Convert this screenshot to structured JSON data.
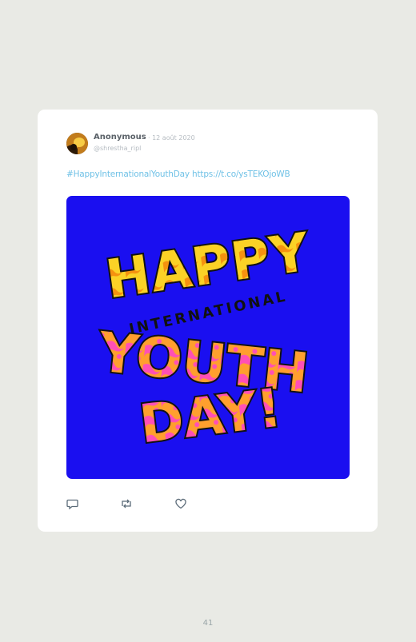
{
  "tweet": {
    "author": "Anonymous",
    "date": "· 12 août 2020",
    "handle": "@shrestha_ripl",
    "hashtag": "#HappyInternationalYouthDay",
    "link": "https://t.co/ysTEKOjoWB",
    "media": {
      "background": "#1a0ff0",
      "line1": "HAPPY",
      "line2": "INTERNATIONAL",
      "line3": "YOUTH",
      "line4": "DAY!"
    },
    "actions": [
      "reply-icon",
      "retweet-icon",
      "like-icon"
    ]
  },
  "page_number": "41"
}
